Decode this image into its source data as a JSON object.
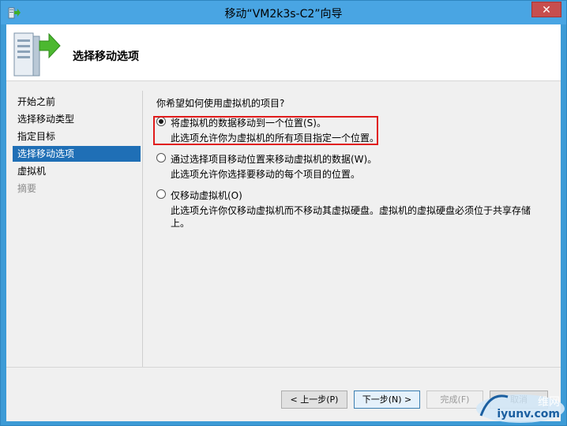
{
  "window": {
    "title": "移动“VM2k3s-C2”向导",
    "close_glyph": "✕"
  },
  "header": {
    "title": "选择移动选项",
    "icon": "server-arrow-icon"
  },
  "sidebar": {
    "items": [
      {
        "label": "开始之前",
        "state": "normal"
      },
      {
        "label": "选择移动类型",
        "state": "normal"
      },
      {
        "label": "指定目标",
        "state": "normal"
      },
      {
        "label": "选择移动选项",
        "state": "active"
      },
      {
        "label": "虚拟机",
        "state": "normal"
      },
      {
        "label": "摘要",
        "state": "disabled"
      }
    ]
  },
  "main": {
    "question": "你希望如何使用虚拟机的项目?",
    "options": [
      {
        "label": "将虚拟机的数据移动到一个位置(S)。",
        "description": "此选项允许你为虚拟机的所有项目指定一个位置。",
        "selected": true
      },
      {
        "label": "通过选择项目移动位置来移动虚拟机的数据(W)。",
        "description": "此选项允许你选择要移动的每个项目的位置。",
        "selected": false
      },
      {
        "label": "仅移动虚拟机(O)",
        "description": "此选项允许你仅移动虚拟机而不移动其虚拟硬盘。虚拟机的虚拟硬盘必须位于共享存储",
        "description2": "上。",
        "selected": false
      }
    ]
  },
  "footer": {
    "prev_label": "< 上一步(P)",
    "next_label": "下一步(N) >",
    "finish_label": "完成(F)",
    "cancel_label": "取消"
  },
  "watermark": {
    "line1": "维网",
    "line2": "iyunv.com"
  },
  "colors": {
    "titlebar": "#49a5e3",
    "active_item": "#1f6fb6",
    "highlight": "#e01b1b"
  }
}
